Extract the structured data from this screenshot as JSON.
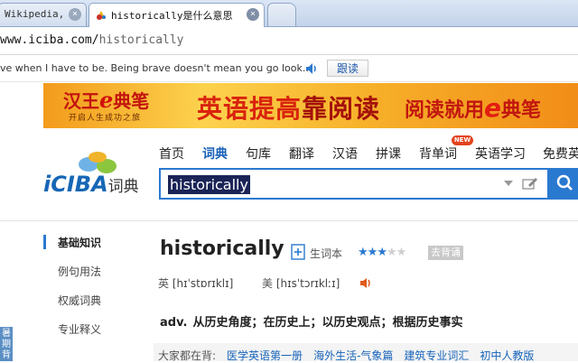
{
  "tabs": [
    {
      "label": "Wikipedia, t",
      "active": false
    },
    {
      "label": "historically是什么意思",
      "active": true
    },
    {
      "label": "",
      "active": false
    }
  ],
  "address": {
    "host": "www.iciba.com/",
    "path": "historically"
  },
  "quote": {
    "text": "ve when I have to be. Being brave doesn't mean you go look...",
    "read_label": "跟读"
  },
  "banner": {
    "logo_a": "汉王",
    "logo_e": "e",
    "logo_b": "典笔",
    "slogan": "开启人生成功之旅",
    "headline": "英语提高",
    "headline_b": "靠阅读",
    "headline2_a": "阅读就用",
    "headline2_e": "e",
    "headline2_b": "典笔"
  },
  "nav": {
    "items": [
      "首页",
      "词典",
      "句库",
      "翻译",
      "汉语",
      "拼课",
      "背单词",
      "英语学习",
      "免费英"
    ],
    "active_index": 1,
    "new_badge": "NEW"
  },
  "site_logo": {
    "text": "iCIBA",
    "suffix": "词典"
  },
  "search": {
    "value": "historically"
  },
  "side_menu": {
    "items": [
      "基础知识",
      "例句用法",
      "权威词典",
      "专业释义"
    ],
    "active_index": 0
  },
  "left_strip": {
    "text": "暑期背"
  },
  "entry": {
    "word": "historically",
    "vocab_label": "生词本",
    "stars_filled": 3,
    "stars_total": 5,
    "tag_label": "去背诵",
    "uk_label": "英",
    "uk_phon": "[hɪˈstɒrɪklɪ]",
    "us_label": "美",
    "us_phon": "[hɪsˈtɔrɪklːɪ]",
    "pos": "adv.",
    "definition": "从历史角度；在历史上；以历史观点；根据历史事实"
  },
  "recent": {
    "label": "大家都在背:",
    "links": [
      "医学英语第一册",
      "海外生活-气象篇",
      "建筑专业词汇",
      "初中人教版"
    ]
  },
  "colors": {
    "accent": "#2a79d0",
    "nav_active": "#1760b8",
    "banner_red": "#d9230e"
  }
}
